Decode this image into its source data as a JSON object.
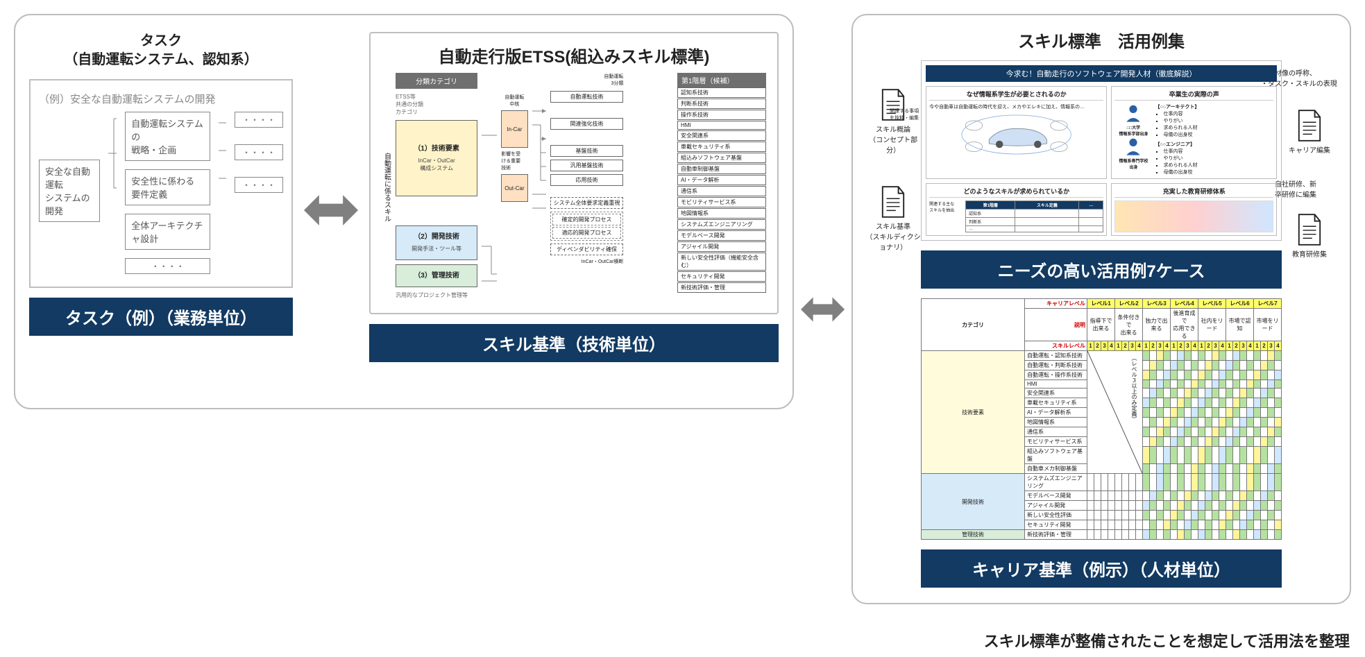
{
  "left": {
    "title_line1": "タスク",
    "title_line2": "（自動運転システム、認知系）",
    "example_label": "（例）安全な自動運転システムの開発",
    "root": "安全な自動運転\nシステムの開発",
    "nodes": [
      "自動運転システムの\n戦略・企画",
      "安全性に係わる\n要件定義",
      "全体アーキテクチャ設計"
    ],
    "more_dots": "・・・・",
    "caption": "タスク（例）（業務単位）"
  },
  "center": {
    "title": "自動走行版ETSS(組込みスキル標準)",
    "side_label": "自動運転に係るスキル",
    "cat_header": "分類カテゴリ",
    "common_cat": "ETSS等\n共通の分類\nカテゴリ",
    "tech1": {
      "ttl": "（1）技術要素",
      "sub": "InCar・OutCar\n構成システム"
    },
    "tech2": {
      "ttl": "（2）開発技術",
      "sub": "開発手法・ツール等"
    },
    "tech3": {
      "ttl": "（3）管理技術",
      "sub": "汎用的なプロジェクト管理等"
    },
    "mid_core": "自動運転\n中核",
    "incar": "In-Car",
    "outcar": "Out-Car",
    "autotech": "自動運転技術",
    "related": "関連強化技術",
    "base": "基盤技術",
    "gen_base": "汎用基盤技術",
    "applied": "応用技術",
    "note_left": "影響を受\nける重要\n技術",
    "note_top": "自動運転\n3分類",
    "hier_label": "第1階層（候補）",
    "hier": [
      "認知系技術",
      "判断系技術",
      "操作系技術",
      "HMI",
      "安全関連系",
      "車載セキュリティ系",
      "組込みソフトウェア基盤",
      "自動車制御基盤",
      "AI・データ解析",
      "通信系",
      "モビリティサービス系",
      "地図情報系",
      "システムズエンジニアリング",
      "モデルベース開発",
      "アジャイル開発",
      "新しい安全性評価（機能安全含む）",
      "セキュリティ開発",
      "新技術評価・管理"
    ],
    "dash1": "システム全体要求定義重視",
    "dash_sub": [
      "確定的開発プロセス",
      "適応的開発プロセス"
    ],
    "dash2": "ディペンダビリティ確保",
    "footnote": "InCar・OutCar横断",
    "caption": "スキル基準（技術単位）"
  },
  "right": {
    "title": "スキル標準　活用例集",
    "usage_header": "今求む！自動走行のソフトウェア開発人材（徹底解説）",
    "box1": {
      "title": "なぜ情報系学生が必要とされるのか",
      "body": "今や自動車は自動運転の時代を迎え、メカやエレキに加え、情報系の…"
    },
    "box2": {
      "title": "卒業生の実際の声"
    },
    "arch": {
      "name": "【○○アーキテクト】",
      "bullets": [
        "仕事内容",
        "やりがい",
        "求められる人材",
        "母儀の出身校"
      ]
    },
    "eng": {
      "name": "【○○エンジニア】",
      "bullets": [
        "仕事内容",
        "やりがい",
        "求められる人材",
        "母儀の出身校"
      ]
    },
    "uni1": "□□大学\n情報系学部出身",
    "uni2": "情報系専門学校\n出身",
    "box3": {
      "title": "どのようなスキルが求められているか",
      "rows": [
        "認知系",
        "判断系",
        "…"
      ],
      "hdr": [
        "第1階層",
        "スキル定義",
        "…"
      ],
      "sidebody": "関連する主な\nスキルを抽出"
    },
    "box4": {
      "title": "充実した教育研修体系"
    },
    "side_docs": {
      "left_top": "スキル概論\n（コンセプト部分）",
      "left_bottom": "スキル基準\n（スキルディクショナリ）",
      "right_top_a": "・人材像の呼称、",
      "right_top_b": "・タスク・スキルの表現",
      "right_mid": "キャリア編集",
      "right_bottom": "自社研修、新\n卒研修に編集",
      "right_bottom2": "教育研修集"
    },
    "box1_side": "関連する事項\nを抜粋・編集",
    "caption1": "ニーズの高い活用例7ケース",
    "matrix": {
      "cat_hdr": "カテゴリ",
      "career_label": "キャリアレベル",
      "skill_label": "スキルレベル",
      "desc_label": "説明",
      "levels": [
        "レベル1",
        "レベル2",
        "レベル3",
        "レベル4",
        "レベル5",
        "レベル6",
        "レベル7"
      ],
      "level_desc": [
        "指導下で\n出来る",
        "条件付きで\n出来る",
        "独力で出来る",
        "後進育成で\n応用できる",
        "社内をリード",
        "市場で認知",
        "市場をリード"
      ],
      "note": "（レベル３以上のみ定義）",
      "rows_tech": [
        "自動運転・認知系技術",
        "自動運転・判断系技術",
        "自動運転・操作系技術",
        "HMI",
        "安全関連系",
        "車載セキュリティ系",
        "AI・データ解析系",
        "地図情報系",
        "通信系",
        "モビリティサービス系",
        "組込みソフトウェア基盤",
        "自動車メカ制御基盤"
      ],
      "rows_dev": [
        "システムズエンジニアリング",
        "モデルベース開発",
        "アジャイル開発",
        "新しい安全性評価",
        "セキュリティ開発"
      ],
      "rows_mgt": [
        "新技術評価・管理"
      ],
      "cat_tech": "技術要素",
      "cat_dev": "開発技術",
      "cat_mgt": "管理技術"
    },
    "caption2": "キャリア基準（例示）（人材単位）"
  },
  "footnote": "スキル標準が整備されたことを想定して活用法を整理"
}
